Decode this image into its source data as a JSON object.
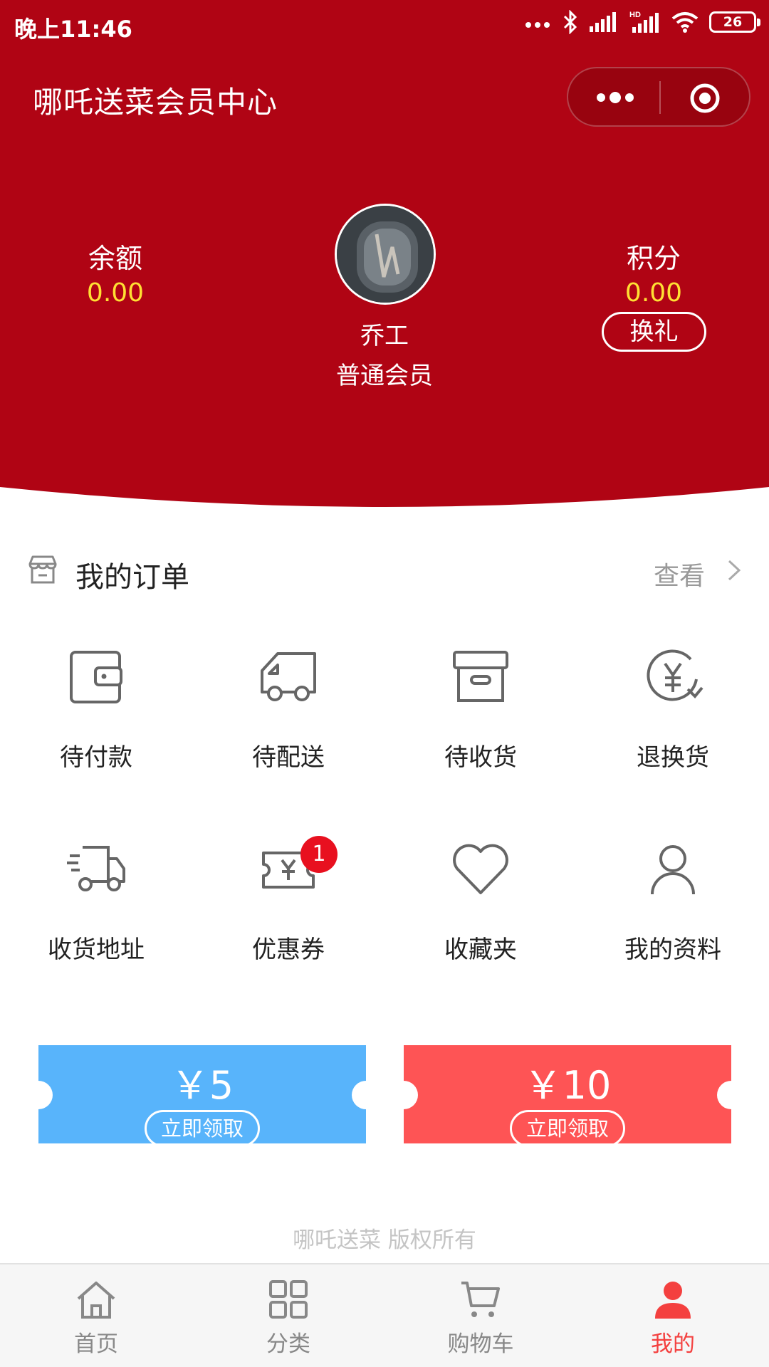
{
  "status_bar": {
    "time": "晚上11:46",
    "battery": "26",
    "network": "HD"
  },
  "header": {
    "title": "哪吒送菜会员中心",
    "balance": {
      "label": "余额",
      "value": "0.00"
    },
    "points": {
      "label": "积分",
      "value": "0.00",
      "button": "换礼"
    },
    "user": {
      "name": "乔工",
      "level": "普通会员"
    }
  },
  "orders": {
    "title": "我的订单",
    "view_all": "查看",
    "items": [
      {
        "label": "待付款",
        "icon": "wallet-icon"
      },
      {
        "label": "待配送",
        "icon": "delivery-truck-icon"
      },
      {
        "label": "待收货",
        "icon": "box-icon"
      },
      {
        "label": "退换货",
        "icon": "refund-icon"
      },
      {
        "label": "收货地址",
        "icon": "shipping-icon"
      },
      {
        "label": "优惠券",
        "icon": "coupon-icon",
        "badge": "1"
      },
      {
        "label": "收藏夹",
        "icon": "heart-icon"
      },
      {
        "label": "我的资料",
        "icon": "user-icon"
      }
    ]
  },
  "coupons": [
    {
      "amount": "￥5",
      "button": "立即领取",
      "color": "#58b4fb"
    },
    {
      "amount": "￥10",
      "button": "立即领取",
      "color": "#fe5455"
    }
  ],
  "footer": {
    "copyright": "哪吒送菜 版权所有"
  },
  "tabbar": {
    "items": [
      {
        "label": "首页",
        "icon": "home-icon"
      },
      {
        "label": "分类",
        "icon": "grid-icon"
      },
      {
        "label": "购物车",
        "icon": "cart-icon"
      },
      {
        "label": "我的",
        "icon": "user-icon",
        "active": true
      }
    ]
  },
  "colors": {
    "brand_red": "#b00414",
    "value_yellow": "#ffe033",
    "active_tab": "#f4403f"
  }
}
